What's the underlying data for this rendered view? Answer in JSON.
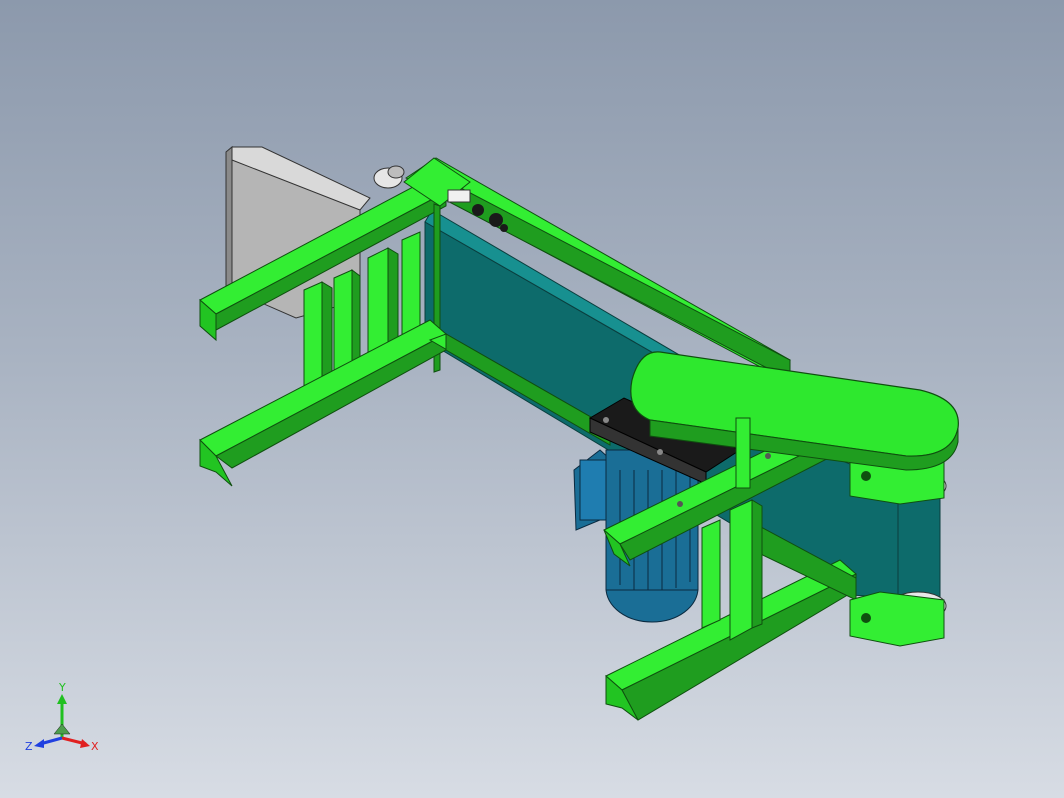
{
  "viewport": {
    "background_top": "#8c99ac",
    "background_bottom": "#d7dce4"
  },
  "model": {
    "frame_color": "#33ee33",
    "frame_shadow": "#1f9d1f",
    "belt_color": "#0d6b6b",
    "cover_color": "#2ee82e",
    "motor_color": "#1a6e96",
    "motor_plate_color": "#1a1a1a",
    "hopper_color": "#b5b5b5"
  },
  "triad": {
    "y_label": "Y",
    "x_label": "X",
    "z_label": "Z",
    "x_color": "#e02020",
    "y_color": "#20c020",
    "z_color": "#2040e0"
  }
}
